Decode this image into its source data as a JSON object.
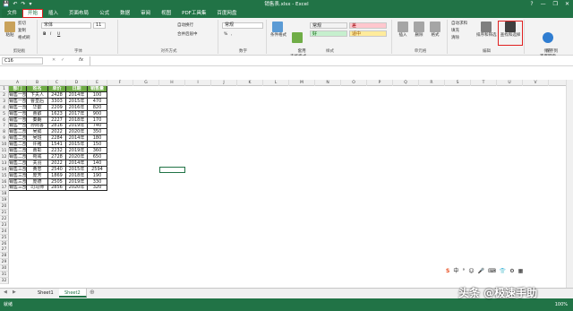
{
  "window": {
    "title": "销售表.xlsx - Excel",
    "minimize": "—",
    "restore": "❐",
    "close": "✕",
    "help": "?"
  },
  "qat": {
    "save": "💾",
    "undo": "↶",
    "redo": "↷",
    "more": "▾"
  },
  "tabs": [
    "文件",
    "开始",
    "插入",
    "页面布局",
    "公式",
    "数据",
    "审阅",
    "视图",
    "PDF工具集",
    "百度网盘"
  ],
  "active_tab": "开始",
  "ribbon": {
    "clipboard": {
      "label": "剪贴板",
      "paste": "粘贴",
      "cut": "剪切",
      "copy": "复制",
      "format_painter": "格式刷"
    },
    "font": {
      "label": "字体",
      "font_name": "宋体",
      "font_size": "11",
      "bold": "B",
      "italic": "I",
      "underline": "U"
    },
    "alignment": {
      "label": "对齐方式",
      "wrap": "自动换行",
      "merge": "合并后居中"
    },
    "number": {
      "label": "数字",
      "format": "常规",
      "percent": "%",
      "comma": ","
    },
    "styles": {
      "label": "样式",
      "conditional": "条件格式",
      "table": "套用\n表格格式",
      "cells": [
        {
          "text": "常规",
          "bg": "#ffffff",
          "fg": "#000000"
        },
        {
          "text": "差",
          "bg": "#ffc7ce",
          "fg": "#9c0006"
        },
        {
          "text": "好",
          "bg": "#c6efce",
          "fg": "#006100"
        },
        {
          "text": "适中",
          "bg": "#ffeb9c",
          "fg": "#9c5700"
        }
      ]
    },
    "cells": {
      "label": "单元格",
      "insert": "插入",
      "delete": "删除",
      "format": "格式"
    },
    "editing": {
      "label": "编辑",
      "autosum": "自动求和",
      "fill": "填充",
      "clear": "清除",
      "sort": "排序和筛选",
      "find": "查找和选择"
    },
    "save": {
      "label": "保存",
      "baidu": "保存到\n百度网盘"
    }
  },
  "formula_bar": {
    "name_box": "C16",
    "fx": "fx"
  },
  "columns": [
    "A",
    "B",
    "C",
    "D",
    "E",
    "F",
    "G",
    "H",
    "I",
    "J",
    "K",
    "L",
    "M",
    "N",
    "O",
    "P",
    "Q",
    "R",
    "S",
    "T",
    "U",
    "V"
  ],
  "table": {
    "headers": [
      "部门",
      "姓名",
      "单价",
      "日期",
      "销售量"
    ],
    "rows": [
      [
        "销售一部",
        "卞夫人",
        "2428",
        "2014年",
        "100"
      ],
      [
        "销售一部",
        "曹皇后",
        "3303",
        "2015年",
        "470"
      ],
      [
        "销售一部",
        "华歆",
        "2209",
        "2016年",
        "820"
      ],
      [
        "销售一部",
        "曹叡",
        "1623",
        "2017年",
        "900"
      ],
      [
        "销售一部",
        "秦朗",
        "2227",
        "2018年",
        "170"
      ],
      [
        "销售一部",
        "孙尚香",
        "2816",
        "2019年",
        "740"
      ],
      [
        "销售二部",
        "吴懿",
        "2022",
        "2020年",
        "350"
      ],
      [
        "销售二部",
        "吴班",
        "2284",
        "2014年",
        "180"
      ],
      [
        "销售二部",
        "许褚",
        "1541",
        "2015年",
        "150"
      ],
      [
        "销售二部",
        "曹彰",
        "2232",
        "2019年",
        "360"
      ],
      [
        "销售二部",
        "荀彧",
        "2728",
        "2020年",
        "650"
      ],
      [
        "销售二部",
        "关羽",
        "2022",
        "2014年",
        "140"
      ],
      [
        "销售三部",
        "黄忠",
        "2540",
        "2015年",
        "2594"
      ],
      [
        "销售三部",
        "庞芳",
        "1869",
        "2018年",
        "190"
      ],
      [
        "销售三部",
        "庞德",
        "2505",
        "2019年",
        "330"
      ],
      [
        "销售三部",
        "司马师",
        "2856",
        "2020年",
        "320"
      ]
    ]
  },
  "row_numbers": [
    "1",
    "2",
    "3",
    "4",
    "5",
    "6",
    "7",
    "8",
    "9",
    "10",
    "11",
    "12",
    "13",
    "14",
    "15",
    "16",
    "17",
    "18",
    "19",
    "20",
    "21",
    "22",
    "23",
    "24",
    "25",
    "26",
    "27",
    "28",
    "29",
    "30",
    "31",
    "32",
    "33",
    "34"
  ],
  "selected_cell": "C16",
  "sheets": [
    "Sheet1",
    "Sheet2"
  ],
  "active_sheet": "Sheet2",
  "status": {
    "ready": "就绪",
    "zoom": "100%"
  },
  "sogou": {
    "logo": "S",
    "mode": "中",
    "items": [
      "°",
      "☺",
      "🎤",
      "⌨",
      "👕",
      "⚙",
      "▦"
    ]
  },
  "watermark": "头条 @极速手助"
}
